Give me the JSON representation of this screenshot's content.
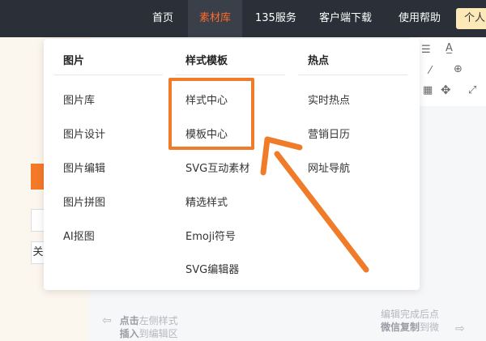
{
  "nav": {
    "items": [
      {
        "label": "首页",
        "active": false
      },
      {
        "label": "素材库",
        "active": true
      },
      {
        "label": "135服务",
        "active": false
      },
      {
        "label": "客户端下载",
        "active": false
      },
      {
        "label": "使用帮助",
        "active": false
      }
    ],
    "personal_button": "个人"
  },
  "dropdown": {
    "columns": [
      {
        "heading": "图片",
        "links": [
          "图片库",
          "图片设计",
          "图片编辑",
          "图片拼图",
          "AI抠图"
        ]
      },
      {
        "heading": "样式模板",
        "links": [
          "样式中心",
          "模板中心",
          "SVG互动素材",
          "精选样式",
          "Emoji符号",
          "SVG编辑器"
        ]
      },
      {
        "heading": "热点",
        "links": [
          "实时热点",
          "营销日历",
          "网址导航"
        ]
      }
    ]
  },
  "editor": {
    "left_box_text": "关",
    "hint_left": {
      "line1_bold": "点击",
      "line1_rest": "左侧样式",
      "line2_bold": "插入",
      "line2_rest": "到编辑区"
    },
    "hint_right": {
      "line1": "编辑完成后点",
      "line2_bold": "微信复制",
      "line2_rest": "到微"
    }
  },
  "colors": {
    "accent": "#ff6a2a",
    "annotation": "#f07c2a",
    "topbar": "#2b3038"
  },
  "icons": [
    "arrow-left-icon",
    "arrow-right-icon",
    "move-icon",
    "expand-icon",
    "magic-wand-icon",
    "zoom-icon",
    "text-style-icon",
    "align-icon"
  ]
}
